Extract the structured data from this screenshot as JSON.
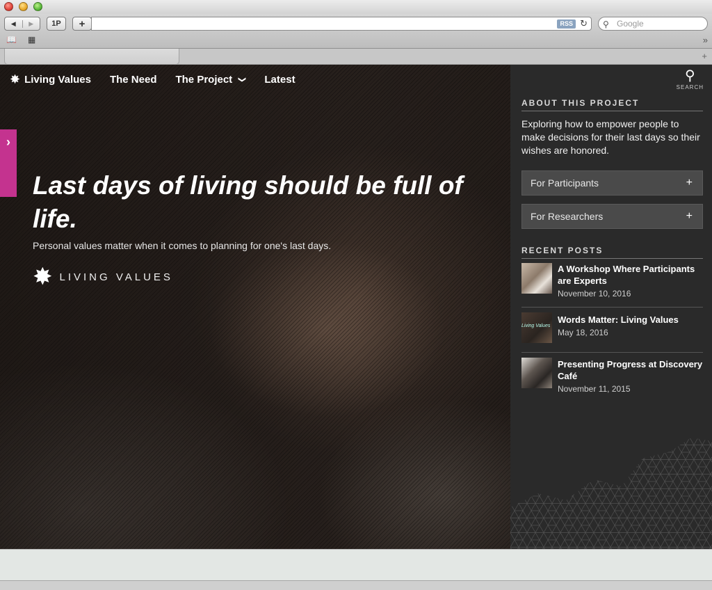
{
  "browser": {
    "back_icon": "◀",
    "forward_icon": "▶",
    "onepassword_label": "1P",
    "add_label": "+",
    "url": "",
    "rss_label": "RSS",
    "reload_icon": "↻",
    "search_placeholder": "Google",
    "tab_add_icon": "+",
    "overflow_icon": "»"
  },
  "nav": {
    "brand": "Living Values",
    "items": [
      "The Need",
      "The Project",
      "Latest"
    ],
    "project_chevron": "❯"
  },
  "side_tab_icon": "›",
  "hero": {
    "title": "Last days of living should be full of life.",
    "subtitle": "Personal values matter when it comes to planning for one's last days.",
    "brand_name": "LIVING VALUES"
  },
  "sidebar": {
    "search_label": "SEARCH",
    "about_heading": "ABOUT THIS PROJECT",
    "about_text": "Exploring how to empower people to make decisions for their last days so their wishes are honored.",
    "accordions": [
      {
        "label": "For Participants",
        "icon": "+"
      },
      {
        "label": "For Researchers",
        "icon": "+"
      }
    ],
    "recent_heading": "RECENT POSTS",
    "posts": [
      {
        "title": "A Workshop Where Participants are Experts",
        "date": "November 10, 2016"
      },
      {
        "title": "Words Matter: Living Values",
        "date": "May 18, 2016",
        "thumb_text": "Living Values"
      },
      {
        "title": "Presenting Progress at Discovery Café",
        "date": "November 11, 2015"
      }
    ]
  },
  "colors": {
    "accent": "#c4338f",
    "sidebar_bg": "#2a2a2a",
    "accordion_bg": "#4a4a4a"
  }
}
